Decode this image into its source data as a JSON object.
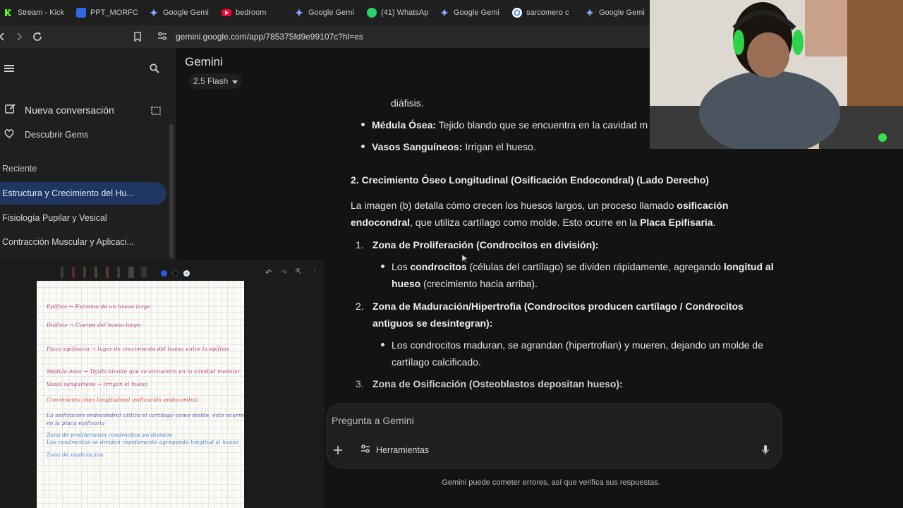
{
  "browser": {
    "tabs": [
      {
        "label": "Stream - Kick",
        "icon": "kick-icon",
        "color": "#53fc18"
      },
      {
        "label": "PPT_MORFOL",
        "icon": "slides-icon",
        "color": "#2b6be6"
      },
      {
        "label": "Google Gemi",
        "icon": "gemini-icon",
        "color": "#7aa7ff"
      },
      {
        "label": "bedroom",
        "icon": "youtube-icon",
        "color": "#ff0033"
      },
      {
        "label": "Google Gemi",
        "icon": "gemini-icon",
        "color": "#7aa7ff"
      },
      {
        "label": "(41) WhatsAp",
        "icon": "whatsapp-icon",
        "color": "#25d366"
      },
      {
        "label": "Google Gemi",
        "icon": "gemini-icon",
        "color": "#7aa7ff"
      },
      {
        "label": "sarcomero c",
        "icon": "google-icon",
        "color": "#ffffff"
      },
      {
        "label": "Google Gemi",
        "icon": "gemini-icon",
        "color": "#7aa7ff"
      }
    ],
    "url": "gemini.google.com/app/785375fd9e99107c?hl=es"
  },
  "sidebar": {
    "new_chat": "Nueva conversación",
    "discover": "Descubrir Gems",
    "recent_header": "Reciente",
    "recent": [
      "Estructura y Crecimiento del Hu...",
      "Fisiología Pupilar y Vesical",
      "Contracción Muscular y Aplicaci..."
    ]
  },
  "header": {
    "title": "Gemini",
    "model": "2.5 Flash"
  },
  "response": {
    "cont_line": "diáfisis.",
    "b1_bold": "Médula Ósea:",
    "b1_text": " Tejido blando que se encuentra en la cavidad m",
    "b2_bold": "Vasos Sanguíneos:",
    "b2_text": " Irrigan el hueso.",
    "heading": "2. Crecimiento Óseo Longitudinal (Osificación Endocondral) (Lado Derecho)",
    "p1_a": "La imagen (b) detalla cómo crecen los huesos largos, un proceso llamado ",
    "p1_b": "osificación",
    "p2_a": "endocondral",
    "p2_b": ", que utiliza cartílago como molde. Esto ocurre en la ",
    "p2_c": "Placa Epifisaria",
    "p2_d": ".",
    "n1_num": "1.",
    "n1_text": "Zona de Proliferación (Condrocitos en división):",
    "n1_b_a": "Los ",
    "n1_b_b": "condrocitos",
    "n1_b_c": " (células del cartílago) se dividen rápidamente, agregando ",
    "n1_b_d": "longitud al",
    "n1_b_e": "hueso",
    "n1_b_f": " (crecimiento hacia arriba).",
    "n2_num": "2.",
    "n2_line1": "Zona de Maduración/Hipertrofia (Condrocitos producen cartílago / Condrocitos",
    "n2_line2": "antiguos se desintegran):",
    "n2_b1": "Los condrocitos maduran, se agrandan (hipertrofian) y mueren, dejando un molde de",
    "n2_b2": "cartílago calcificado.",
    "n3_num": "3.",
    "n3_text": "Zona de Osificación (Osteoblastos depositan hueso):"
  },
  "prompt": {
    "placeholder": "Pregunta a Gemini",
    "tools": "Herramientas"
  },
  "footer": {
    "disclaimer": "Gemini puede cometer errores, así que verifica sus respuestas."
  },
  "notes": {
    "lines": [
      {
        "text": "Epífisis → Extremo de un hueso largo",
        "color": "#c23a7a"
      },
      {
        "text": "Diáfisis → Cuerpo del hueso largo",
        "color": "#c23a7a"
      },
      {
        "text": "Placa epifisaria → lugar de crecimiento del hueso entre la epífisis",
        "color": "#c23a7a"
      },
      {
        "text": "Médula ósea → Tejido blando que se encuentra en la cavidad medular",
        "color": "#c23a7a"
      },
      {
        "text": "Vasos sanguíneos → Irrigan el hueso",
        "color": "#c23a7a"
      },
      {
        "text": "Crecimiento óseo longitudinal   osificación endocondral",
        "color": "#d8403a"
      },
      {
        "text": "La osificación endocondral utiliza el cartílago como molde, esto ocurre",
        "color": "#6a4fb8"
      },
      {
        "text": "en la placa epifisaria",
        "color": "#6a4fb8"
      },
      {
        "text": "Zona de proliferación condrocitos en división",
        "color": "#4a7fd4"
      },
      {
        "text": "Los condrocitos se dividen rápidamente agregando longitud al hueso",
        "color": "#4a7fd4"
      },
      {
        "text": "Zona de maduración",
        "color": "#4a7fd4"
      }
    ]
  }
}
